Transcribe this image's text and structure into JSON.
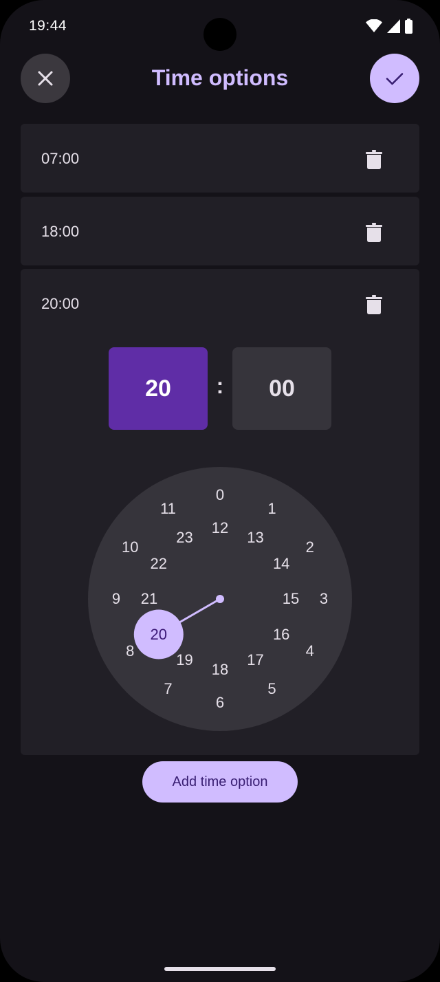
{
  "status_bar": {
    "time": "19:44",
    "icons": [
      "wifi-icon",
      "cellular-signal-icon",
      "battery-icon"
    ]
  },
  "top_bar": {
    "title": "Time options",
    "close_icon": "close-icon",
    "confirm_icon": "check-icon"
  },
  "time_options": [
    {
      "label": "07:00",
      "delete_icon": "trash-icon"
    },
    {
      "label": "18:00",
      "delete_icon": "trash-icon"
    },
    {
      "label": "20:00",
      "delete_icon": "trash-icon",
      "expanded": true
    }
  ],
  "picker": {
    "hour": "20",
    "separator": ":",
    "minute": "00",
    "selected_hour": 20,
    "outer_ring": [
      "0",
      "1",
      "2",
      "3",
      "4",
      "5",
      "6",
      "7",
      "8",
      "9",
      "10",
      "11"
    ],
    "inner_ring": [
      "12",
      "13",
      "14",
      "15",
      "16",
      "17",
      "18",
      "19",
      "20",
      "21",
      "22",
      "23"
    ]
  },
  "add_button": {
    "label": "Add time option"
  },
  "colors": {
    "background": "#141218",
    "surface": "#211f26",
    "accent": "#d0bcff",
    "selected_field": "#5f2da6",
    "dial": "#36343b",
    "text": "#e6e0e9"
  }
}
